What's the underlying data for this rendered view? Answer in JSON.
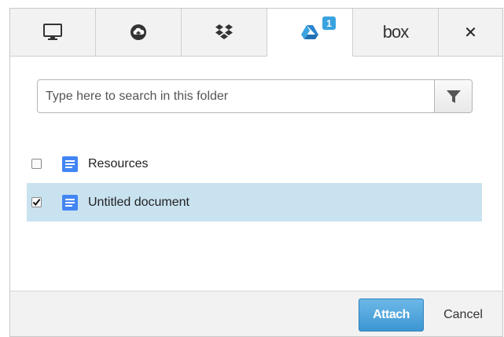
{
  "tabs": {
    "items": [
      {
        "icon": "computer-monitor-icon",
        "active": false
      },
      {
        "icon": "cloud-upload-icon",
        "active": false
      },
      {
        "icon": "dropbox-icon",
        "active": false
      },
      {
        "icon": "google-drive-icon",
        "active": true,
        "badge": "1"
      },
      {
        "icon": "box-logo",
        "label": "box",
        "active": false
      }
    ],
    "close_glyph": "✕"
  },
  "search": {
    "placeholder": "Type here to search in this folder",
    "value": ""
  },
  "files": [
    {
      "name": "Resources",
      "checked": false,
      "icon": "google-doc-icon"
    },
    {
      "name": "Untitled document",
      "checked": true,
      "icon": "google-doc-icon"
    }
  ],
  "footer": {
    "attach_label": "Attach",
    "cancel_label": "Cancel"
  },
  "colors": {
    "accent": "#3d96d2",
    "selected_row": "#c9e2f0",
    "badge": "#3aa3df",
    "doc_icon": "#4285f4"
  }
}
